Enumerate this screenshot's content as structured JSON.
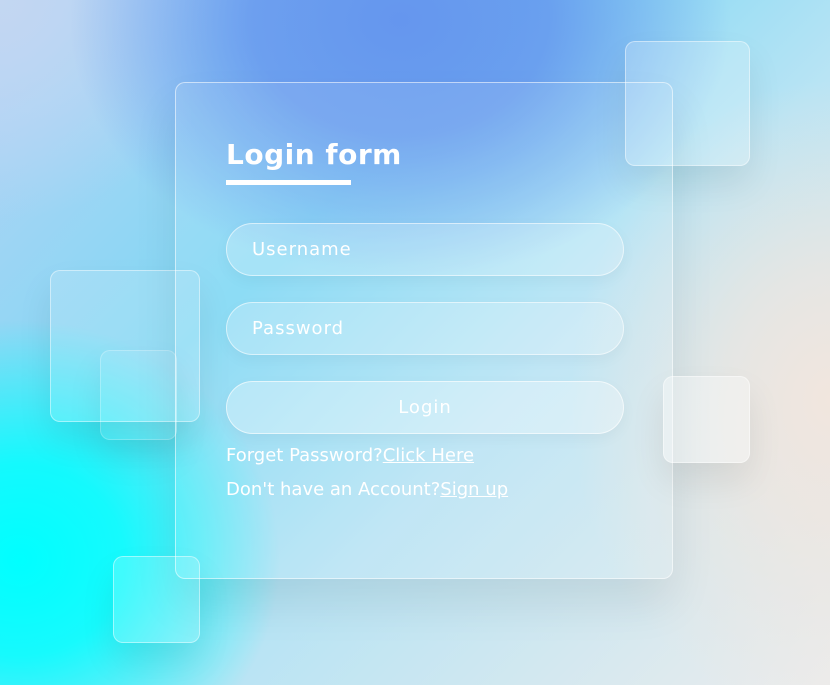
{
  "form": {
    "title": "Login form",
    "username_placeholder": "Username",
    "password_placeholder": "Password",
    "login_label": "Login",
    "forgot_prefix": "Forget Password?",
    "forgot_link": "Click Here",
    "signup_prefix": "Don't have an Account?",
    "signup_link": "Sign up"
  },
  "colors": {
    "text": "#ffffff",
    "background_cyan": "#00ffff",
    "background_blue": "#6596ee",
    "background_warm": "#f1e6de"
  }
}
